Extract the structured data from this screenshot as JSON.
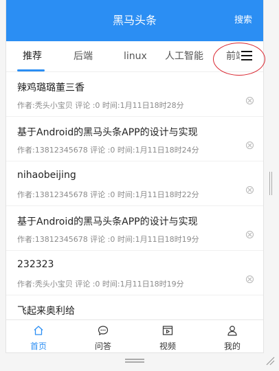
{
  "header": {
    "title": "黑马头条",
    "search_label": "搜索"
  },
  "tabs": [
    {
      "label": "推荐",
      "active": true
    },
    {
      "label": "后端"
    },
    {
      "label": "linux"
    },
    {
      "label": "人工智能"
    },
    {
      "label": "前端"
    }
  ],
  "articles": [
    {
      "title": "辣鸡璐璐董三香",
      "meta": "作者:秃头小宝贝 评论 :0 时间:1月11日18时28分"
    },
    {
      "title": "基于Android的黑马头条APP的设计与实现",
      "meta": "作者:13812345678 评论 :0 时间:1月11日18时24分"
    },
    {
      "title": "nihaobeijing",
      "meta": "作者:13812345678 评论 :0 时间:1月11日18时22分"
    },
    {
      "title": "基于Android的黑马头条APP的设计与实现",
      "meta": "作者:13812345678 评论 :0 时间:1月11日18时19分"
    },
    {
      "title": "232323",
      "meta": "作者:秃头小宝贝 评论 :0 时间:1月11日18时19分"
    },
    {
      "title": "飞起来奥利给",
      "meta": ""
    }
  ],
  "bottom_nav": [
    {
      "label": "首页",
      "icon": "home-icon",
      "active": true
    },
    {
      "label": "问答",
      "icon": "chat-bubble-icon"
    },
    {
      "label": "视频",
      "icon": "video-icon"
    },
    {
      "label": "我的",
      "icon": "user-icon"
    }
  ],
  "colors": {
    "primary": "#2b8ef3",
    "highlight": "#d9232d"
  }
}
